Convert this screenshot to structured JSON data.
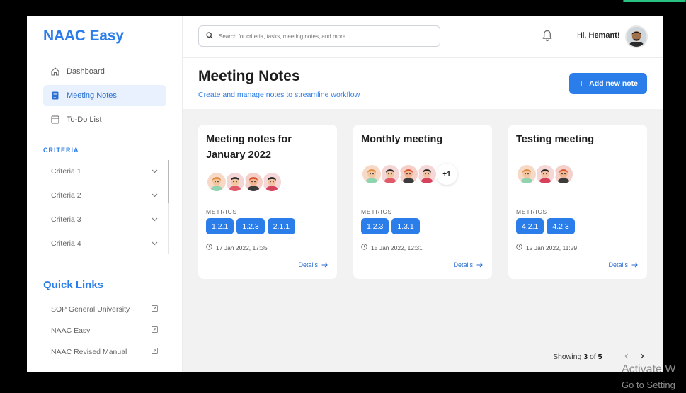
{
  "app": {
    "logo": "NAAC Easy"
  },
  "nav": [
    {
      "label": "Dashboard",
      "icon": "home-icon"
    },
    {
      "label": "Meeting Notes",
      "icon": "notes-icon",
      "active": true
    },
    {
      "label": "To-Do List",
      "icon": "list-icon"
    }
  ],
  "criteria": {
    "heading": "CRITERIA",
    "items": [
      "Criteria 1",
      "Criteria 2",
      "Criteria 3",
      "Criteria 4"
    ]
  },
  "quick_links": {
    "heading": "Quick Links",
    "items": [
      "SOP General University",
      "NAAC Easy",
      "NAAC Revised Manual"
    ]
  },
  "topbar": {
    "search_placeholder": "Search for criteria, tasks, meeting notes, and more...",
    "greeting_prefix": "Hi, ",
    "user_name": "Hemant!"
  },
  "page": {
    "title": "Meeting Notes",
    "subtitle": "Create and manage notes to streamline workflow",
    "add_button": "Add new note"
  },
  "cards": [
    {
      "title": "Meeting notes for January 2022",
      "attendee_count": 4,
      "extra_attendees": "",
      "metrics_label": "METRICS",
      "metrics": [
        "1.2.1",
        "1.2.3",
        "2.1.1"
      ],
      "date": "17 Jan 2022, 17:35",
      "details": "Details"
    },
    {
      "title": "Monthly meeting",
      "attendee_count": 4,
      "extra_attendees": "+1",
      "metrics_label": "METRICS",
      "metrics": [
        "1.2.3",
        "1.3.1"
      ],
      "date": "15 Jan 2022, 12:31",
      "details": "Details"
    },
    {
      "title": "Testing meeting",
      "attendee_count": 3,
      "extra_attendees": "",
      "metrics_label": "METRICS",
      "metrics": [
        "4.2.1",
        "4.2.3"
      ],
      "date": "12 Jan 2022, 11:29",
      "details": "Details"
    }
  ],
  "pagination": {
    "prefix": "Showing ",
    "current": "3",
    "of": " of ",
    "total": "5"
  },
  "watermark": {
    "line1": "Activate W",
    "line2": "Go to Setting"
  },
  "colors": {
    "accent": "#2b7de9",
    "active_bg": "#e8f1fd",
    "content_bg": "#f2f2f2",
    "status_green": "#27c281"
  }
}
